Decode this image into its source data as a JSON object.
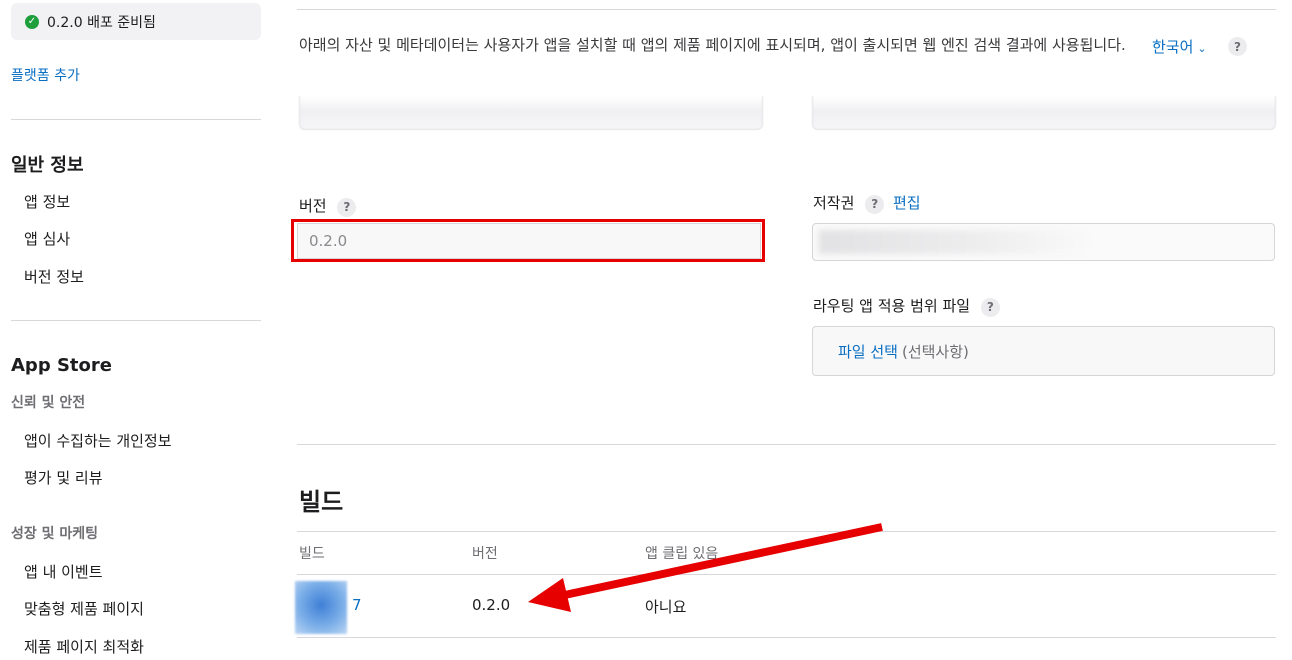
{
  "sidebar": {
    "status": {
      "label": "0.2.0 배포 준비됨",
      "color": "#1f9e3c"
    },
    "add_platform": "플랫폼 추가",
    "general_title": "일반 정보",
    "general_items": [
      "앱 정보",
      "앱 심사",
      "버전 정보"
    ],
    "appstore_title": "App Store",
    "trust_title": "신뢰 및 안전",
    "trust_items": [
      "앱이 수집하는 개인정보",
      "평가 및 리뷰"
    ],
    "growth_title": "성장 및 마케팅",
    "growth_items": [
      "앱 내 이벤트",
      "맞춤형 제품 페이지",
      "제품 페이지 최적화"
    ]
  },
  "main": {
    "description": "아래의 자산 및 메타데이터는 사용자가 앱을 설치할 때 앱의 제품 페이지에 표시되며, 앱이 출시되면 웹 엔진 검색 결과에 사용됩니다.",
    "language": "한국어",
    "help_symbol": "?",
    "version_label": "버전",
    "version_value": "0.2.0",
    "copyright_label": "저작권",
    "copyright_edit": "편집",
    "routing_label": "라우팅 앱 적용 범위 파일",
    "file_select": "파일 선택",
    "file_optional": "(선택사항)",
    "build_section_title": "빌드",
    "build_table": {
      "headers": [
        "빌드",
        "버전",
        "앱 클립 있음"
      ],
      "row": {
        "build": "7",
        "version": "0.2.0",
        "app_clip": "아니요"
      }
    }
  },
  "colors": {
    "accent": "#0a6fc2",
    "highlight": "#e60000"
  }
}
